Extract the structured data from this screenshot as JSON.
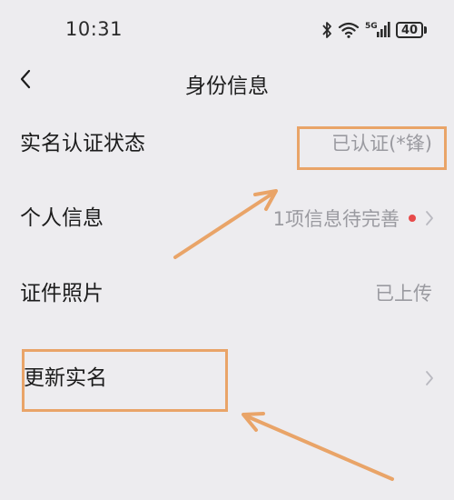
{
  "status_bar": {
    "time": "10:31",
    "battery": "40",
    "network": "5G",
    "icons": [
      "bluetooth-icon",
      "wifi-icon",
      "signal-icon",
      "battery-icon"
    ]
  },
  "header": {
    "title": "身份信息",
    "back_icon": "chevron-left-icon"
  },
  "rows": [
    {
      "label": "实名认证状态",
      "value": "已认证(*锋)",
      "chevron": false,
      "dot": false
    },
    {
      "label": "个人信息",
      "value": "1项信息待完善",
      "chevron": true,
      "dot": true
    },
    {
      "label": "证件照片",
      "value": "已上传",
      "chevron": false,
      "dot": false
    },
    {
      "label": "更新实名",
      "value": "",
      "chevron": true,
      "dot": false
    }
  ],
  "colors": {
    "background": "#edecef",
    "annotation": "#e9a468",
    "dot": "#e74a4a",
    "secondary_text": "#9a9aa0"
  }
}
